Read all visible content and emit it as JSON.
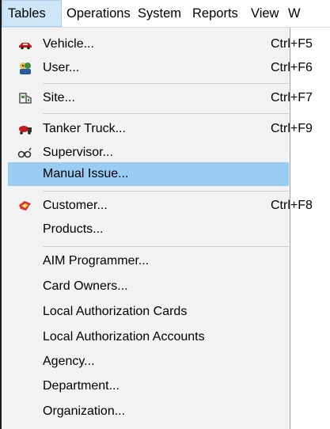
{
  "menubar": {
    "items": [
      "Tables",
      "Operations",
      "System",
      "Reports",
      "View",
      "W"
    ]
  },
  "menu": {
    "items": [
      {
        "label": "Vehicle...",
        "shortcut": "Ctrl+F5",
        "icon": "vehicle-icon"
      },
      {
        "label": "User...",
        "shortcut": "Ctrl+F6",
        "icon": "user-icon"
      },
      {
        "label": "Site...",
        "shortcut": "Ctrl+F7",
        "icon": "site-icon"
      },
      {
        "label": "Tanker Truck...",
        "shortcut": "Ctrl+F9",
        "icon": "tanker-truck-icon"
      },
      {
        "label": "Supervisor...",
        "shortcut": "",
        "icon": "supervisor-icon"
      },
      {
        "label": "Manual Issue...",
        "shortcut": "",
        "icon": ""
      },
      {
        "label": "Customer...",
        "shortcut": "Ctrl+F8",
        "icon": "customer-icon"
      },
      {
        "label": "Products...",
        "shortcut": "",
        "icon": ""
      },
      {
        "label": "AIM Programmer...",
        "shortcut": "",
        "icon": ""
      },
      {
        "label": "Card Owners...",
        "shortcut": "",
        "icon": ""
      },
      {
        "label": "Local Authorization Cards",
        "shortcut": "",
        "icon": ""
      },
      {
        "label": "Local Authorization Accounts",
        "shortcut": "",
        "icon": ""
      },
      {
        "label": "Agency...",
        "shortcut": "",
        "icon": ""
      },
      {
        "label": "Department...",
        "shortcut": "",
        "icon": ""
      },
      {
        "label": "Organization...",
        "shortcut": "",
        "icon": ""
      }
    ],
    "highlighted": "Manual Issue..."
  },
  "colors": {
    "menubar_active": "#cde6f7",
    "highlight": "#99ccf2",
    "dropdown_bg": "#f2f2f2"
  }
}
